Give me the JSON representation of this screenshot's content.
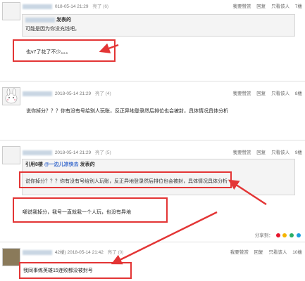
{
  "posts": [
    {
      "date": "018-05-14 21:29",
      "like": "亮了 (6)",
      "floor": "7楼",
      "quote_header": "发表的",
      "quote_text": "可能是因为你没充钱吧。",
      "reply": "也v7了花了不少。。。",
      "actions": [
        "我要赞赏",
        "回复",
        "只看该人"
      ]
    },
    {
      "date": "2018-05-14 21:29",
      "like": "亮了 (4)",
      "floor": "",
      "reply": "说你掉分？？？你有没有号给别人玩账，反正异地登录然后排位也会被封，具体情况具体分析",
      "actions": [
        "我要赞赏",
        "回复",
        "只看该人",
        "8楼"
      ]
    },
    {
      "date": "2018-05-14 21:29",
      "like": "亮了 (5)",
      "floor": "9楼",
      "quote_prefix": "引用8楼",
      "quote_user": "@一边儿凉快去",
      "quote_header": "发表的",
      "quote_text": "说你掉分？？？你有没有号给别人玩账，反正异地登录然后排位也会被封，具体情况具体分析",
      "reply": "哪说我掉分，我号一直就我一个人玩，也没有异地",
      "share_label": "分享到：",
      "actions": [
        "我要赞赏",
        "回复",
        "只看该人"
      ]
    },
    {
      "date_prefix": "42楼)",
      "date": "2018-05-14 21:42",
      "like": "亮了 (0)",
      "floor": "10楼",
      "reply": "我同事练英雄15连败都没被封号",
      "actions": [
        "我要赞赏",
        "回复",
        "只看该人"
      ]
    }
  ],
  "colors": {
    "annotation_red": "#e33535"
  }
}
